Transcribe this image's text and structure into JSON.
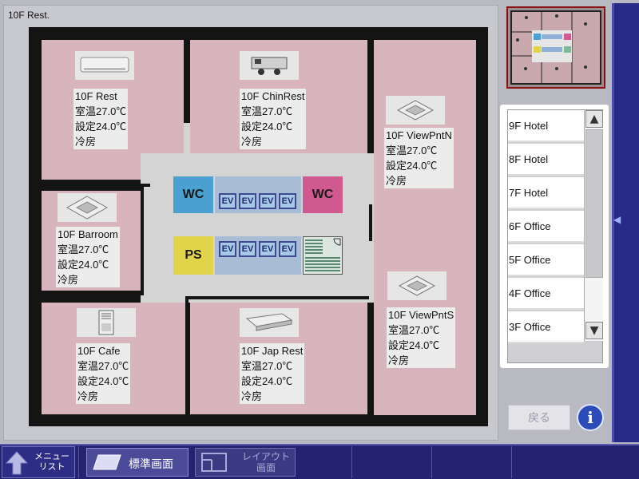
{
  "view": {
    "title": "10F Rest."
  },
  "units": [
    {
      "name": "10F Rest",
      "temp": "室温27.0℃",
      "setpoint": "設定24.0℃",
      "mode": "冷房",
      "icon": "wall-mounted-ac-icon"
    },
    {
      "name": "10F ChinRest",
      "temp": "室温27.0℃",
      "setpoint": "設定24.0℃",
      "mode": "冷房",
      "icon": "ducted-ac-icon"
    },
    {
      "name": "10F ViewPntN",
      "temp": "室温27.0℃",
      "setpoint": "設定24.0℃",
      "mode": "冷房",
      "icon": "ceiling-cassette-icon"
    },
    {
      "name": "10F Barroom",
      "temp": "室温27.0℃",
      "setpoint": "設定24.0℃",
      "mode": "冷房",
      "icon": "ceiling-cassette-icon"
    },
    {
      "name": "10F ViewPntS",
      "temp": "室温27.0℃",
      "setpoint": "設定24.0℃",
      "mode": "冷房",
      "icon": "ceiling-cassette-icon"
    },
    {
      "name": "10F Cafe",
      "temp": "室温27.0℃",
      "setpoint": "設定24.0℃",
      "mode": "冷房",
      "icon": "floor-standing-ac-icon"
    },
    {
      "name": "10F Jap Rest",
      "temp": "室温27.0℃",
      "setpoint": "設定24.0℃",
      "mode": "冷房",
      "icon": "ceiling-suspended-ac-icon"
    }
  ],
  "core": {
    "wc_label": "WC",
    "ps_label": "PS",
    "ev_label": "EV",
    "colors": {
      "wc_left": "#4aa0d0",
      "wc_right": "#d05a90",
      "ps": "#e2d44a",
      "ev_block": "#9fb5d0",
      "stairs": "#7fb89a"
    }
  },
  "floors": [
    "9F Hotel",
    "8F Hotel",
    "7F Hotel",
    "6F Office",
    "5F Office",
    "4F Office",
    "3F Office"
  ],
  "controls": {
    "back": "戻る",
    "info_icon": "info-icon",
    "menu_line1": "メニュー",
    "menu_line2": "リスト",
    "standard_view": "標準画面",
    "layout_line1": "レイアウト",
    "layout_line2": "画面"
  },
  "colors": {
    "room": "#d8b5bc",
    "wall": "#141414",
    "toolbar": "#23236f"
  }
}
